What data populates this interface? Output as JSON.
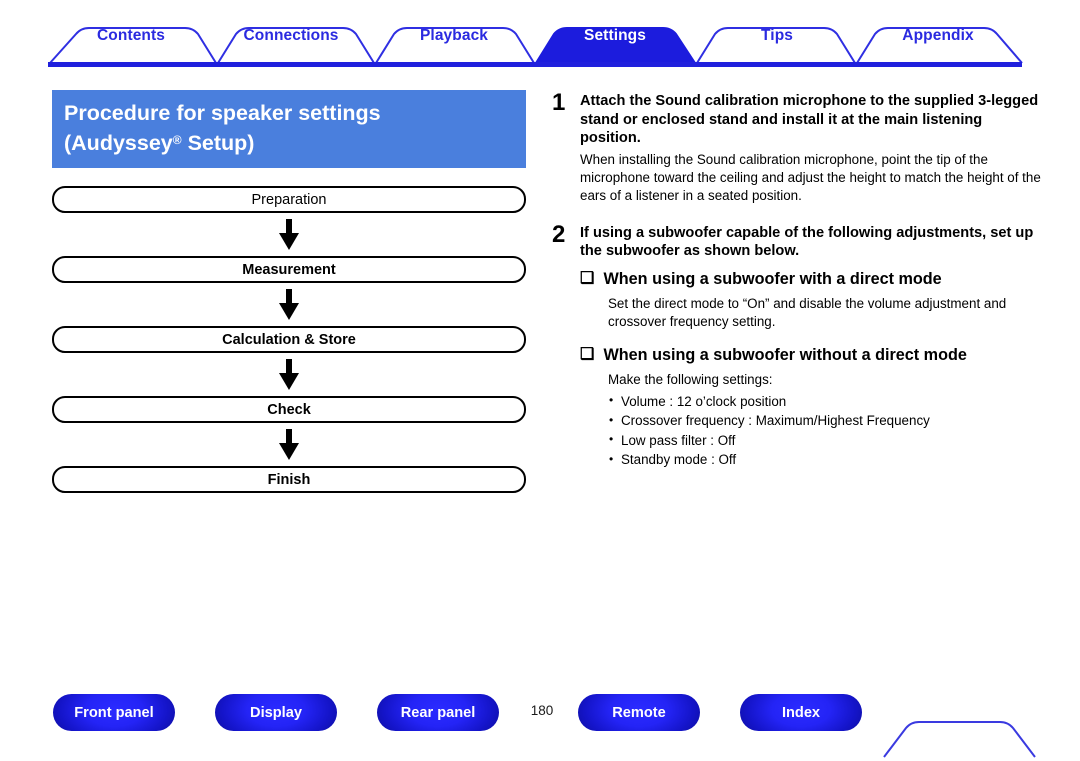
{
  "colors": {
    "tab_blue": "#2a2ae0",
    "tab_active_fill": "#1c1cdd",
    "title_bg": "#4a7fdd",
    "button_blue": "#2424f6",
    "rule": "#2020dd"
  },
  "tabs": [
    {
      "label": "Contents",
      "active": false
    },
    {
      "label": "Connections",
      "active": false
    },
    {
      "label": "Playback",
      "active": false
    },
    {
      "label": "Settings",
      "active": true
    },
    {
      "label": "Tips",
      "active": false
    },
    {
      "label": "Appendix",
      "active": false
    }
  ],
  "page_title": {
    "line1": "Procedure for speaker settings",
    "line2_prefix": "(Audyssey",
    "line2_mark": "®",
    "line2_suffix": " Setup)"
  },
  "flowchart": {
    "steps": [
      {
        "label": "Preparation",
        "bold": false
      },
      {
        "label": "Measurement",
        "bold": true
      },
      {
        "label": "Calculation & Store",
        "bold": true
      },
      {
        "label": "Check",
        "bold": true
      },
      {
        "label": "Finish",
        "bold": true
      }
    ],
    "arrow_icon": "down-arrow-icon"
  },
  "steps": [
    {
      "number": "1",
      "heading": "Attach the Sound calibration microphone to the supplied 3-legged stand or enclosed stand and install it at the main listening position.",
      "description": "When installing the Sound calibration microphone, point the tip of the microphone toward the ceiling and adjust the height to match the height of the ears of a listener in a seated position."
    },
    {
      "number": "2",
      "heading": "If using a subwoofer capable of the following adjustments, set up the subwoofer as shown below.",
      "subsections": [
        {
          "glyph": "❑",
          "title": "When using a subwoofer with a direct mode",
          "description": "Set the direct mode to “On” and disable the volume adjustment and crossover frequency setting.",
          "bullets": []
        },
        {
          "glyph": "❑",
          "title": "When using a subwoofer without a direct mode",
          "description": "Make the following settings:",
          "bullets": [
            "Volume : 12 o’clock position",
            "Crossover frequency : Maximum/Highest Frequency",
            "Low pass filter : Off",
            "Standby mode : Off"
          ]
        }
      ]
    }
  ],
  "footer": {
    "buttons": [
      {
        "label": "Front panel"
      },
      {
        "label": "Display"
      },
      {
        "label": "Rear panel"
      },
      {
        "label": "Remote"
      },
      {
        "label": "Index"
      }
    ],
    "page_number": "180"
  }
}
